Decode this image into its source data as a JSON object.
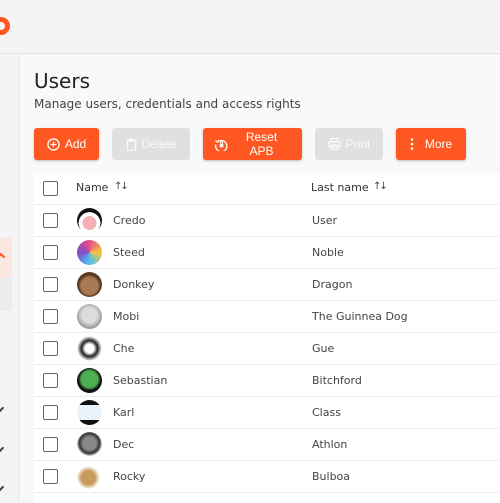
{
  "page": {
    "title": "Users",
    "subtitle": "Manage users, credentials and access rights"
  },
  "toolbar": {
    "add_label": "Add",
    "delete_label": "Delete",
    "reset_apb_label": "Reset APB",
    "print_label": "Print",
    "more_label": "More"
  },
  "colors": {
    "accent": "#ff5722",
    "disabled": "#e0e0e0"
  },
  "table": {
    "columns": [
      {
        "label": "Name",
        "sort_icon": "sort-icon"
      },
      {
        "label": "Last name",
        "sort_icon": "sort-icon"
      }
    ],
    "sort_glyph": "↑↓",
    "rows": [
      {
        "first": "Credo",
        "last": "User",
        "avatar": "clown-avatar"
      },
      {
        "first": "Steed",
        "last": "Noble",
        "avatar": "unicorn-avatar"
      },
      {
        "first": "Donkey",
        "last": "Dragon",
        "avatar": "donkey-avatar"
      },
      {
        "first": "Mobi",
        "last": "The Guinnea Dog",
        "avatar": "dog-avatar"
      },
      {
        "first": "Che",
        "last": "Gue",
        "avatar": "portrait-avatar"
      },
      {
        "first": "Sebastian",
        "last": "Bitchford",
        "avatar": "green-heart-avatar"
      },
      {
        "first": "Karl",
        "last": "Class",
        "avatar": "screen-avatar"
      },
      {
        "first": "Dec",
        "last": "Athlon",
        "avatar": "helmet-avatar"
      },
      {
        "first": "Rocky",
        "last": "Bulboa",
        "avatar": "potato-avatar"
      }
    ]
  }
}
